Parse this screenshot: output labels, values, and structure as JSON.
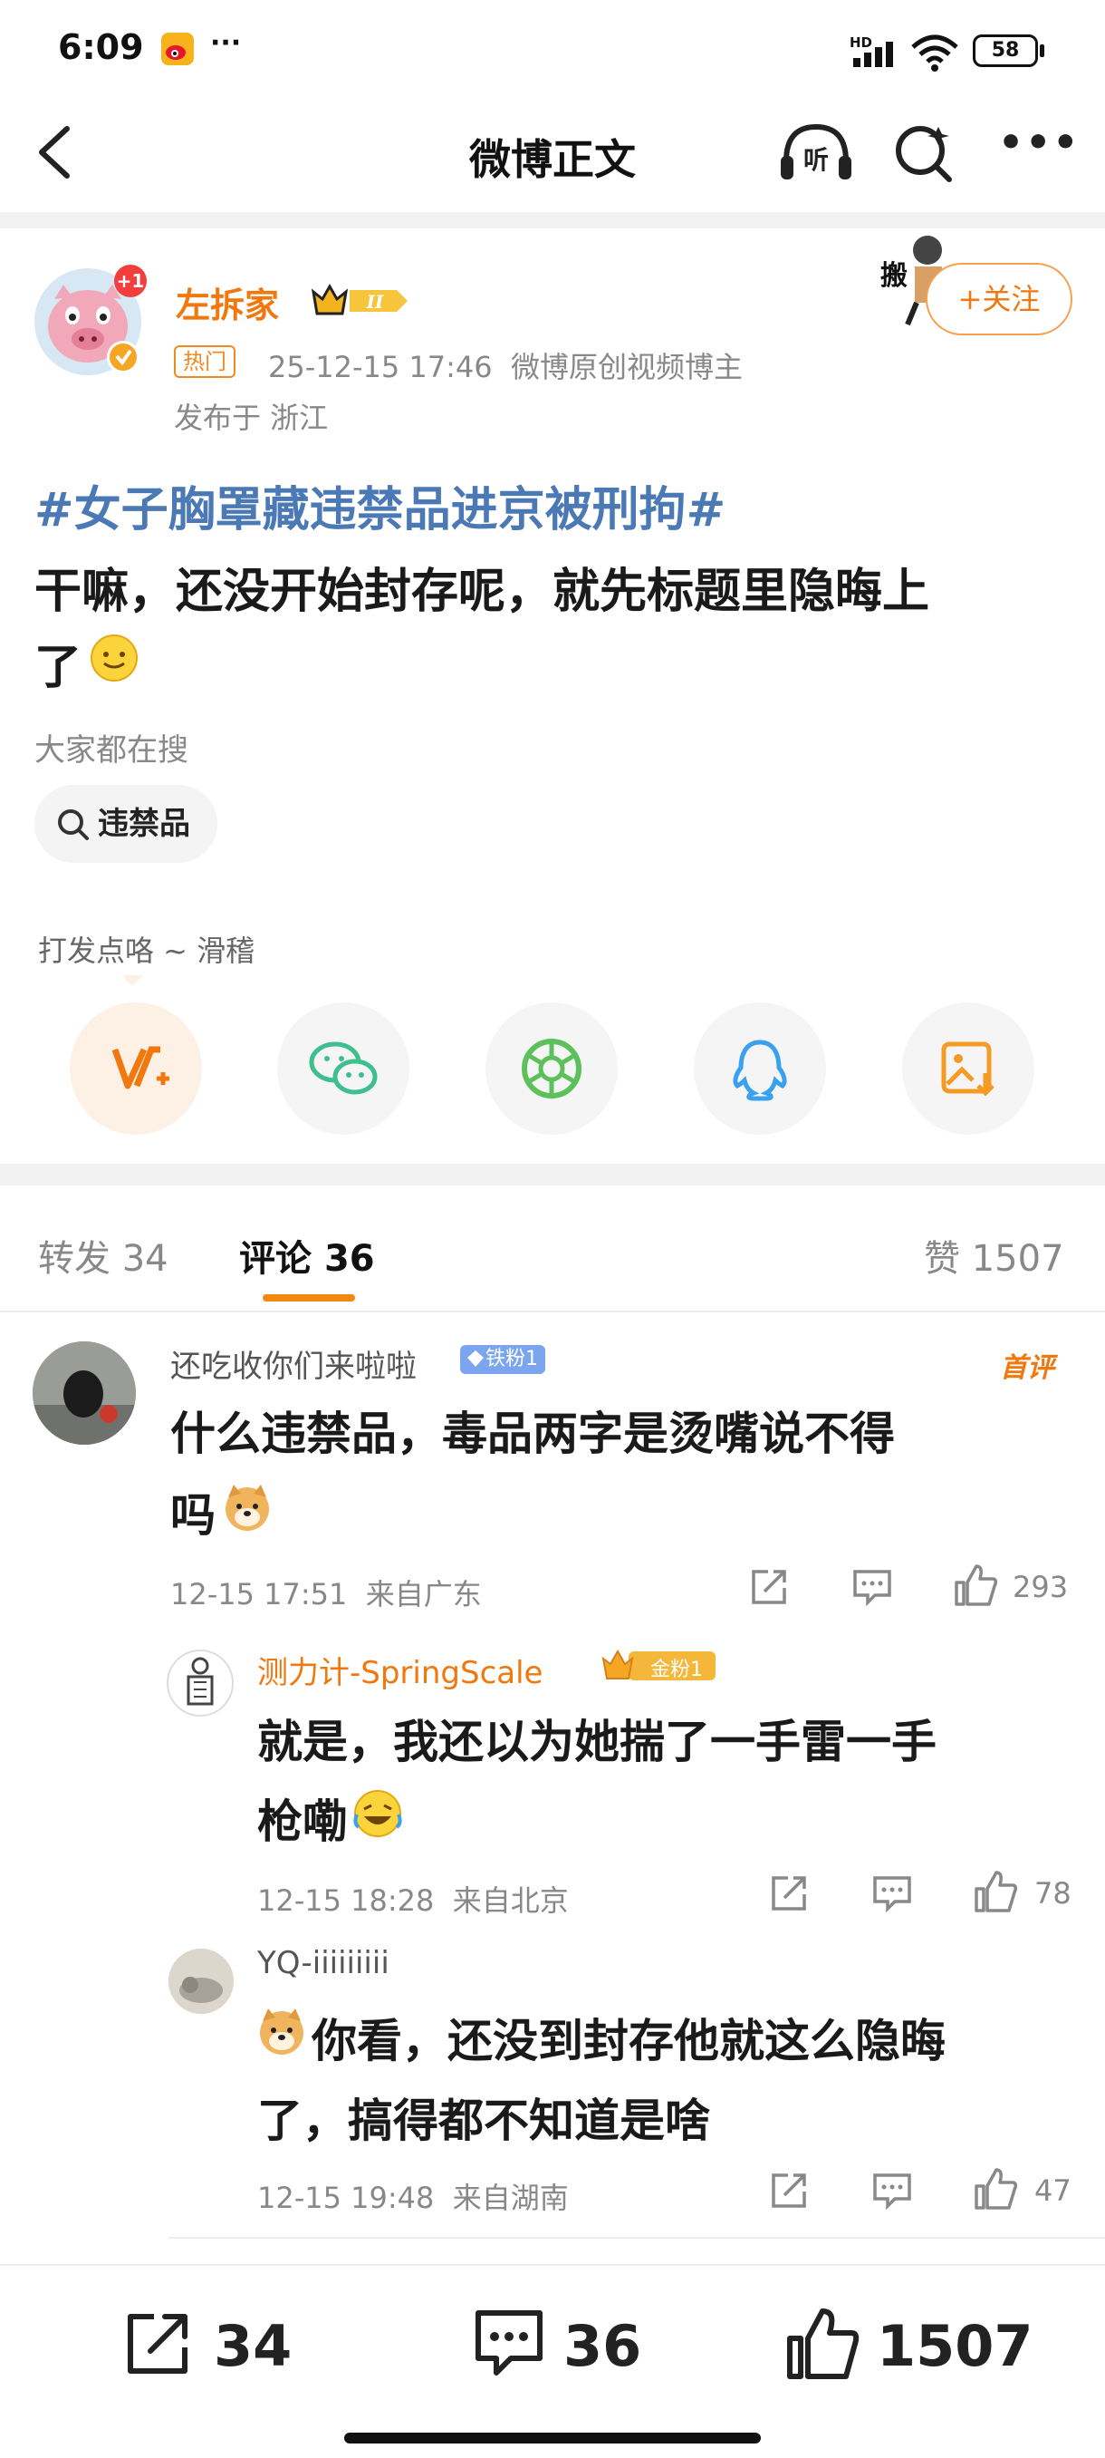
{
  "status_bar": {
    "time": "6:09",
    "network": "HD",
    "battery": "58"
  },
  "header": {
    "title": "微博正文"
  },
  "post": {
    "author": {
      "name": "左拆家",
      "level": "II"
    },
    "hot_badge": "热门",
    "meta": "25-12-15 17:46  微博原创视频博主",
    "location": "发布于 浙江",
    "follow_label": "+关注",
    "hashtag": "#女子胸罩藏违禁品进京被刑拘#",
    "text_lines": [
      "干嘛，还没开始封存呢，就先标题里隐晦上",
      "了"
    ],
    "everyone_search_label": "大家都在搜",
    "search_chip": "违禁品",
    "reward_text": "打发点咯 ~ 滑稽",
    "share_icons": [
      "vplus-icon",
      "wechat-icon",
      "moments-icon",
      "qq-icon",
      "save-image-icon"
    ]
  },
  "tabs": [
    {
      "label": "转发",
      "count": "34"
    },
    {
      "label": "评论",
      "count": "36"
    },
    {
      "label": "赞",
      "count": "1507"
    }
  ],
  "comments": [
    {
      "user": "还吃收你们来啦啦",
      "badge": "铁粉1",
      "first_badge": "首评",
      "text_lines": [
        "什么违禁品，毒品两字是烫嘴说不得",
        "吗"
      ],
      "meta": "12-15 17:51  来自广东",
      "likes": "293"
    },
    {
      "user": "测力计-SpringScale",
      "badge": "金粉1",
      "text_lines": [
        "就是，我还以为她揣了一手雷一手",
        "枪嘞"
      ],
      "meta": "12-15 18:28  来自北京",
      "likes": "78"
    },
    {
      "user": "YQ-iiiiiiiii",
      "text_lines": [
        "你看，还没到封存他就这么隐晦",
        "了，搞得都不知道是啥"
      ],
      "meta": "12-15 19:48  来自湖南",
      "likes": "47"
    }
  ],
  "bottom_bar": {
    "reposts": "34",
    "comments": "36",
    "likes": "1507"
  },
  "colors": {
    "accent": "#f0780f",
    "link": "#4a79b5",
    "wechat": "#3fbf8f",
    "qq": "#3aa0f0"
  }
}
